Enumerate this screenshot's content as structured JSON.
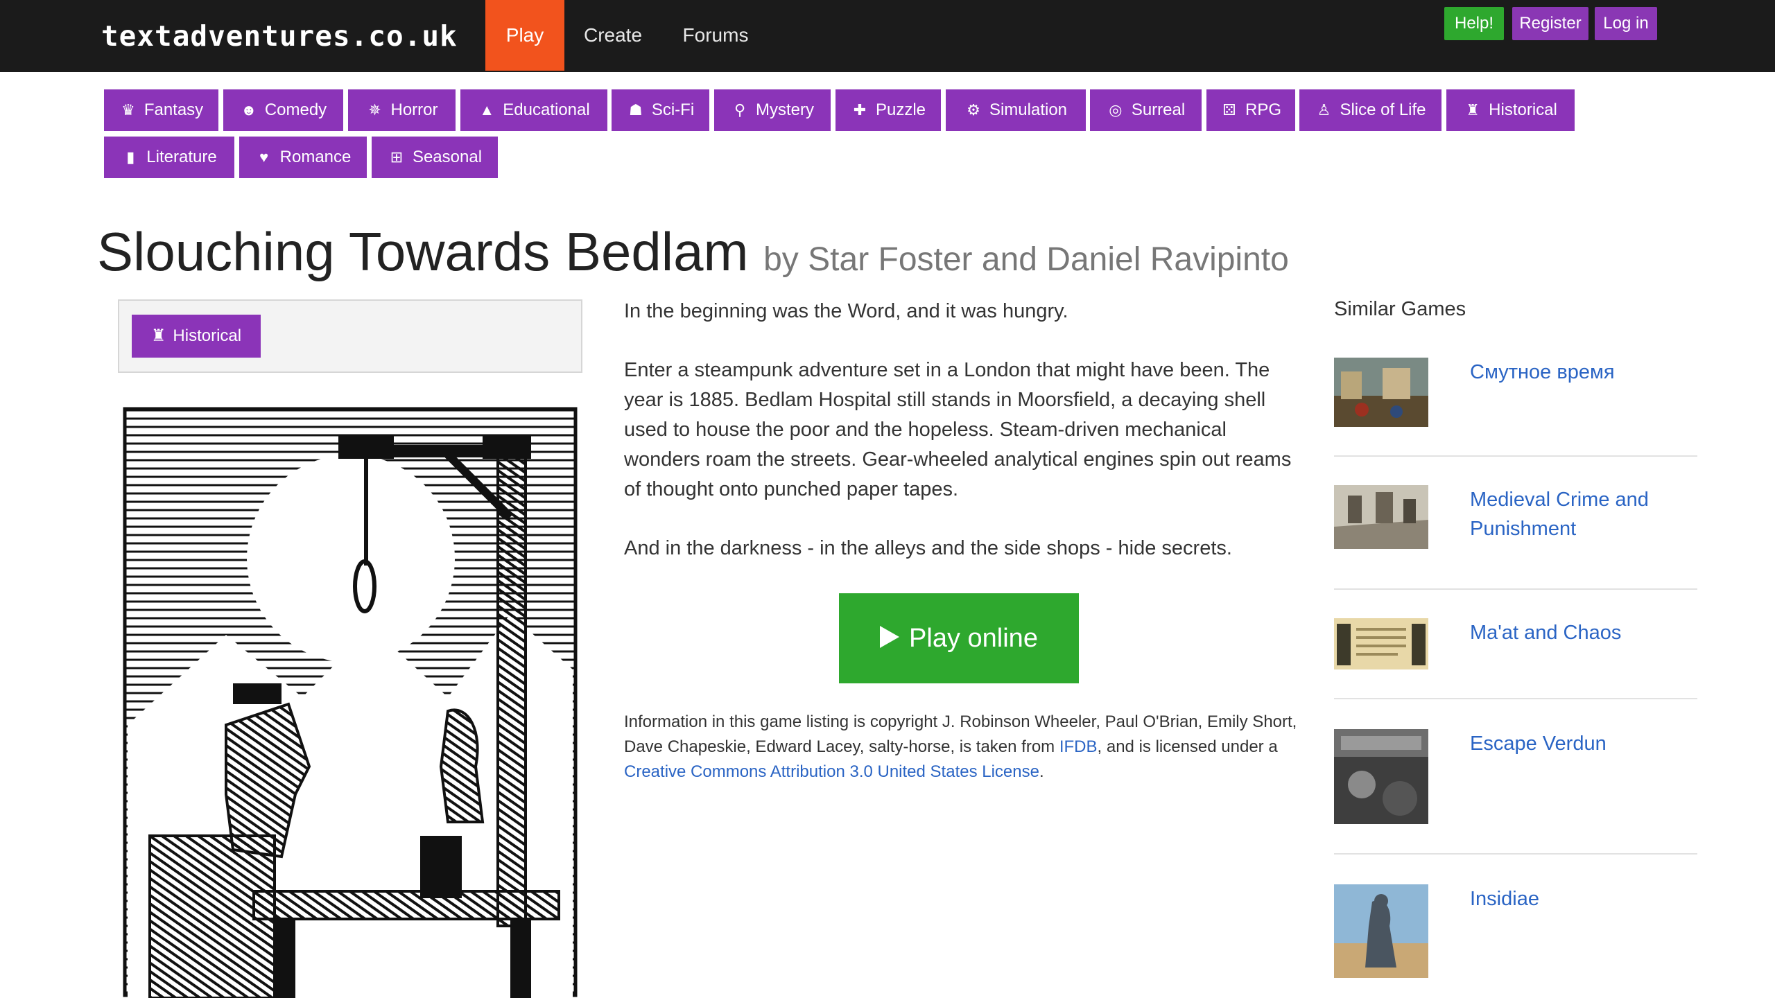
{
  "navbar": {
    "brand": "textadventures.co.uk",
    "links": [
      {
        "label": "Play"
      },
      {
        "label": "Create"
      },
      {
        "label": "Forums"
      }
    ],
    "help": "Help!",
    "register": "Register",
    "login": "Log in"
  },
  "categories": [
    {
      "label": "Fantasy",
      "icon": "crown-icon"
    },
    {
      "label": "Comedy",
      "icon": "smiley-icon"
    },
    {
      "label": "Horror",
      "icon": "spider-icon"
    },
    {
      "label": "Educational",
      "icon": "graduation-cap-icon"
    },
    {
      "label": "Sci-Fi",
      "icon": "alien-icon"
    },
    {
      "label": "Mystery",
      "icon": "magnifier-icon"
    },
    {
      "label": "Puzzle",
      "icon": "puzzle-icon"
    },
    {
      "label": "Simulation",
      "icon": "gears-icon"
    },
    {
      "label": "Surreal",
      "icon": "spiral-icon"
    },
    {
      "label": "RPG",
      "icon": "dice-icon"
    },
    {
      "label": "Slice of Life",
      "icon": "walking-person-icon"
    },
    {
      "label": "Historical",
      "icon": "chess-rook-icon"
    },
    {
      "label": "Literature",
      "icon": "book-icon"
    },
    {
      "label": "Romance",
      "icon": "heart-icon"
    },
    {
      "label": "Seasonal",
      "icon": "gift-icon"
    }
  ],
  "game": {
    "title": "Slouching Towards Bedlam",
    "byline": "by Star Foster and Daniel Ravipinto",
    "tag": "Historical",
    "description": [
      "In the beginning was the Word, and it was hungry.",
      "Enter a steampunk adventure set in a London that might have been. The year is 1885. Bedlam Hospital still stands in Moorsfield, a decaying shell used to house the poor and the hopeless. Steam-driven mechanical wonders roam the streets. Gear-wheeled analytical engines spin out reams of thought onto punched paper tapes.",
      "And in the darkness - in the alleys and the side shops - hide secrets."
    ],
    "play_label": "Play online",
    "legal_prefix": "Information in this game listing is copyright J. Robinson Wheeler, Paul O'Brian, Emily Short, Dave Chapeskie, Edward Lacey, salty-horse, is taken from ",
    "legal_link1": "IFDB",
    "legal_mid": ", and is licensed under a ",
    "legal_link2": "Creative Commons Attribution 3.0 United States License",
    "legal_suffix": "."
  },
  "similar": {
    "heading": "Similar Games",
    "games": [
      {
        "name": "Смутное время"
      },
      {
        "name": "Medieval Crime and Punishment"
      },
      {
        "name": "Ma'at and Chaos"
      },
      {
        "name": "Escape Verdun"
      },
      {
        "name": "Insidiae"
      }
    ]
  },
  "colors": {
    "navbar_bg": "#1b1b1b",
    "active_tab": "#f2531d",
    "category_purple": "#8b34b8",
    "play_green": "#2ea82e",
    "link_blue": "#2a64c4"
  }
}
